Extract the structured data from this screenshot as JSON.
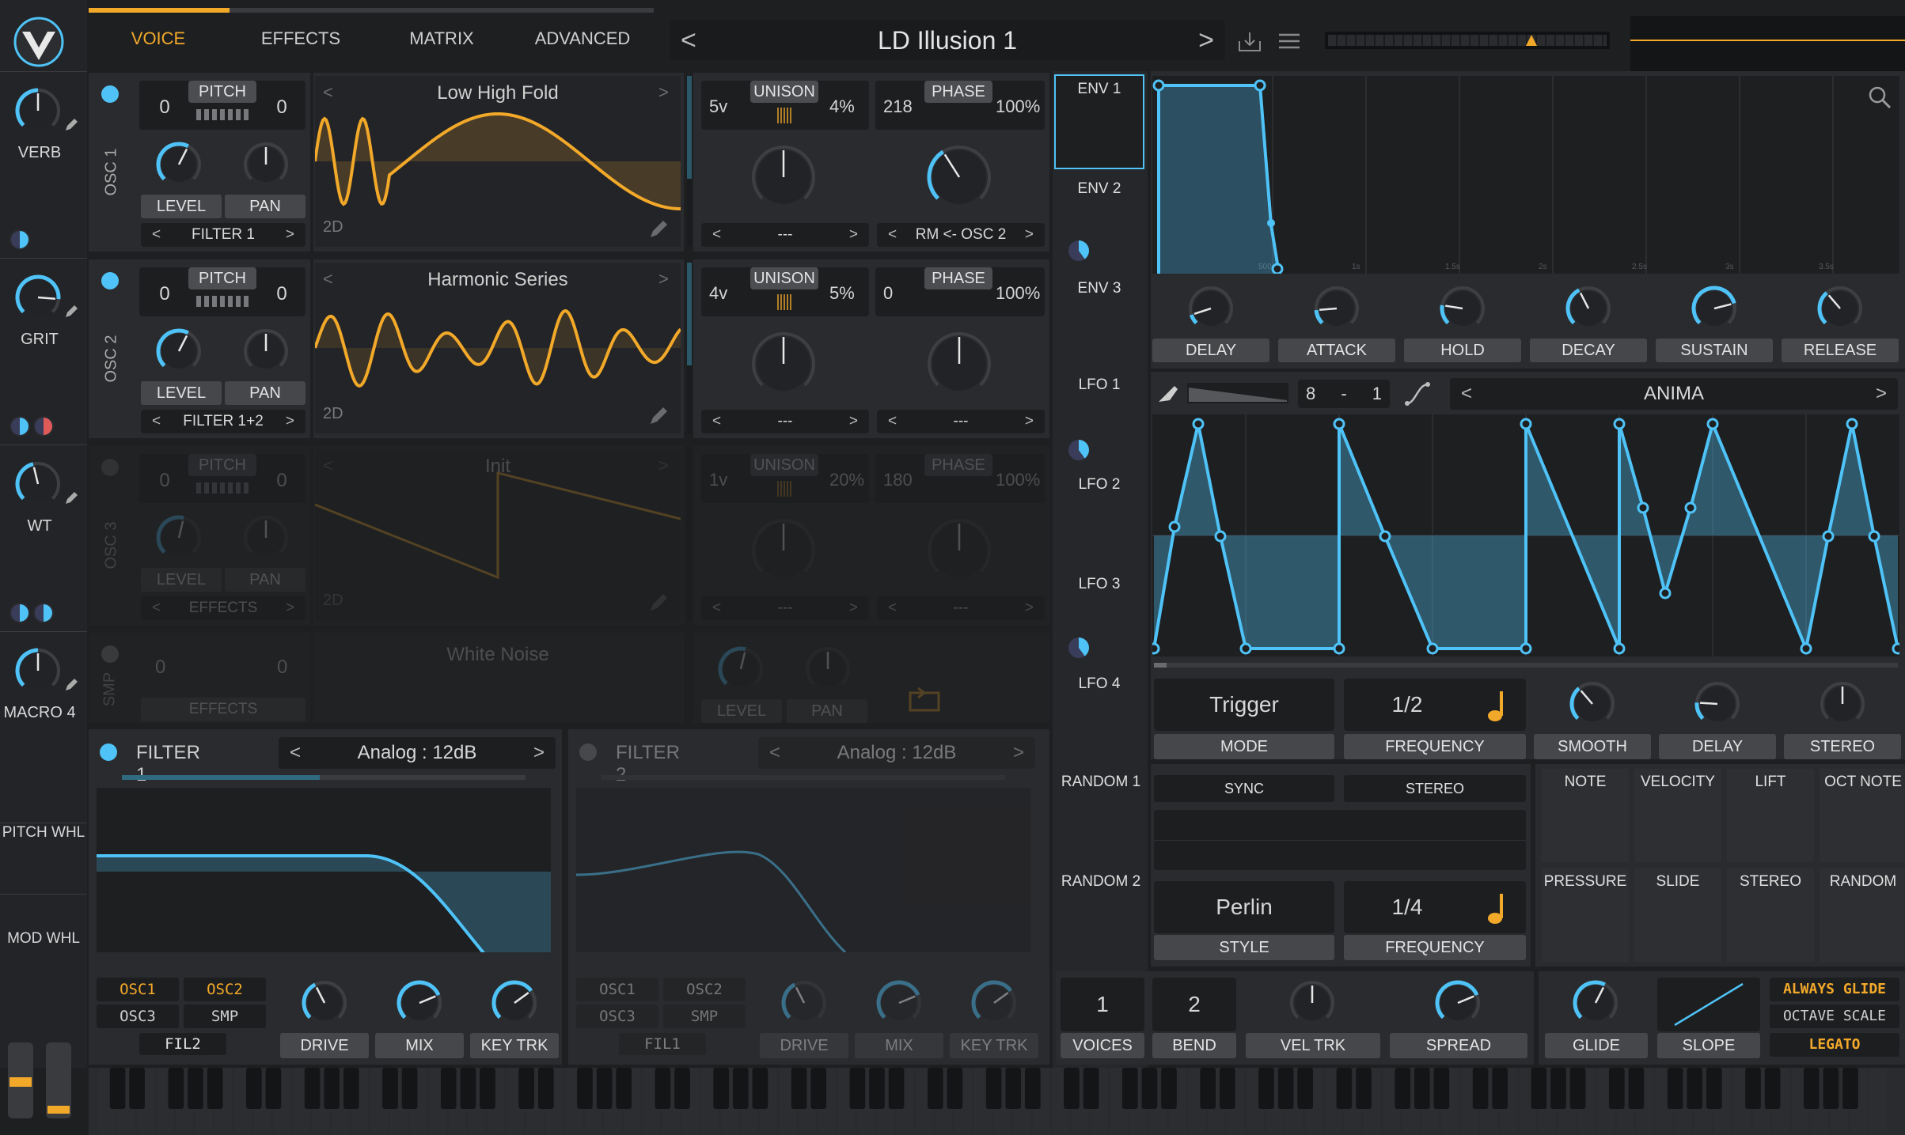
{
  "header": {
    "tabs": [
      "VOICE",
      "EFFECTS",
      "MATRIX",
      "ADVANCED"
    ],
    "active_tab": "VOICE",
    "preset_name": "LD Illusion 1",
    "prev": "<",
    "next": ">"
  },
  "macros": [
    {
      "label": "VERB"
    },
    {
      "label": "GRIT"
    },
    {
      "label": "WT"
    },
    {
      "label": "MACRO 4"
    }
  ],
  "wheels": {
    "pitch": "PITCH WHL",
    "mod": "MOD WHL"
  },
  "osc1": {
    "title": "OSC 1",
    "pitch_label": "PITCH",
    "pitch_l": "0",
    "pitch_r": "0",
    "level": "LEVEL",
    "pan": "PAN",
    "dest": "FILTER 1",
    "wavetable": "Low High Fold",
    "mode": "2D",
    "unison_label": "UNISON",
    "unison_voices": "5v",
    "unison_detune": "4%",
    "phase_label": "PHASE",
    "phase_val": "218",
    "phase_rand": "100%",
    "sel_a": "---",
    "sel_b": "RM <- OSC 2"
  },
  "osc2": {
    "title": "OSC 2",
    "pitch_label": "PITCH",
    "pitch_l": "0",
    "pitch_r": "0",
    "level": "LEVEL",
    "pan": "PAN",
    "dest": "FILTER 1+2",
    "wavetable": "Harmonic Series",
    "mode": "2D",
    "unison_label": "UNISON",
    "unison_voices": "4v",
    "unison_detune": "5%",
    "phase_label": "PHASE",
    "phase_val": "0",
    "phase_rand": "100%",
    "sel_a": "---",
    "sel_b": "---"
  },
  "osc3": {
    "title": "OSC 3",
    "pitch_label": "PITCH",
    "pitch_l": "0",
    "pitch_r": "0",
    "level": "LEVEL",
    "pan": "PAN",
    "dest": "EFFECTS",
    "wavetable": "Init",
    "mode": "2D",
    "unison_label": "UNISON",
    "unison_voices": "1v",
    "unison_detune": "20%",
    "phase_label": "PHASE",
    "phase_val": "180",
    "phase_rand": "100%",
    "sel_a": "---",
    "sel_b": "---"
  },
  "smp": {
    "title": "SMP",
    "pitch_l": "0",
    "pitch_r": "0",
    "dest": "EFFECTS",
    "name": "White Noise",
    "level": "LEVEL",
    "pan": "PAN"
  },
  "filter1": {
    "title": "FILTER 1",
    "model": "Analog : 12dB",
    "sources": [
      "OSC1",
      "OSC2",
      "OSC3",
      "SMP"
    ],
    "fil": "FIL2",
    "drive": "DRIVE",
    "mix": "MIX",
    "keytrk": "KEY TRK"
  },
  "filter2": {
    "title": "FILTER 2",
    "model": "Analog : 12dB",
    "sources": [
      "OSC1",
      "OSC2",
      "OSC3",
      "SMP"
    ],
    "fil": "FIL1",
    "drive": "DRIVE",
    "mix": "MIX",
    "keytrk": "KEY TRK"
  },
  "mod_sources": [
    "ENV 1",
    "ENV 2",
    "ENV 3",
    "LFO 1",
    "LFO 2",
    "LFO 3",
    "LFO 4",
    "RANDOM 1",
    "RANDOM 2"
  ],
  "env": {
    "knobs": [
      "DELAY",
      "ATTACK",
      "HOLD",
      "DECAY",
      "SUSTAIN",
      "RELEASE"
    ],
    "time_ticks": [
      "500m",
      "1s",
      "1.5s",
      "2s",
      "2.5s",
      "3s",
      "3.5s"
    ]
  },
  "lfo": {
    "grid_x": "8",
    "grid_sep": "-",
    "grid_y": "1",
    "shape": "ANIMA",
    "mode_val": "Trigger",
    "mode_label": "MODE",
    "freq_val": "1/2",
    "freq_label": "FREQUENCY",
    "knobs": [
      "SMOOTH",
      "DELAY",
      "STEREO"
    ]
  },
  "random": {
    "sync": "SYNC",
    "stereo": "STEREO",
    "style_val": "Perlin",
    "style_label": "STYLE",
    "freq_val": "1/4",
    "freq_label": "FREQUENCY"
  },
  "mod_targets": [
    "NOTE",
    "VELOCITY",
    "LIFT",
    "OCT NOTE",
    "PRESSURE",
    "SLIDE",
    "STEREO",
    "RANDOM"
  ],
  "voice": {
    "voices_val": "1",
    "voices_label": "VOICES",
    "bend_val": "2",
    "bend_label": "BEND",
    "veltrk": "VEL TRK",
    "spread": "SPREAD",
    "glide": "GLIDE",
    "slope": "SLOPE",
    "always_glide": "ALWAYS GLIDE",
    "octave_scale": "OCTAVE SCALE",
    "legato": "LEGATO"
  },
  "colors": {
    "accent": "#f2a92a",
    "mod": "#4fc3f7",
    "bg": "#1e1f21",
    "panel": "#2a2b2e"
  }
}
